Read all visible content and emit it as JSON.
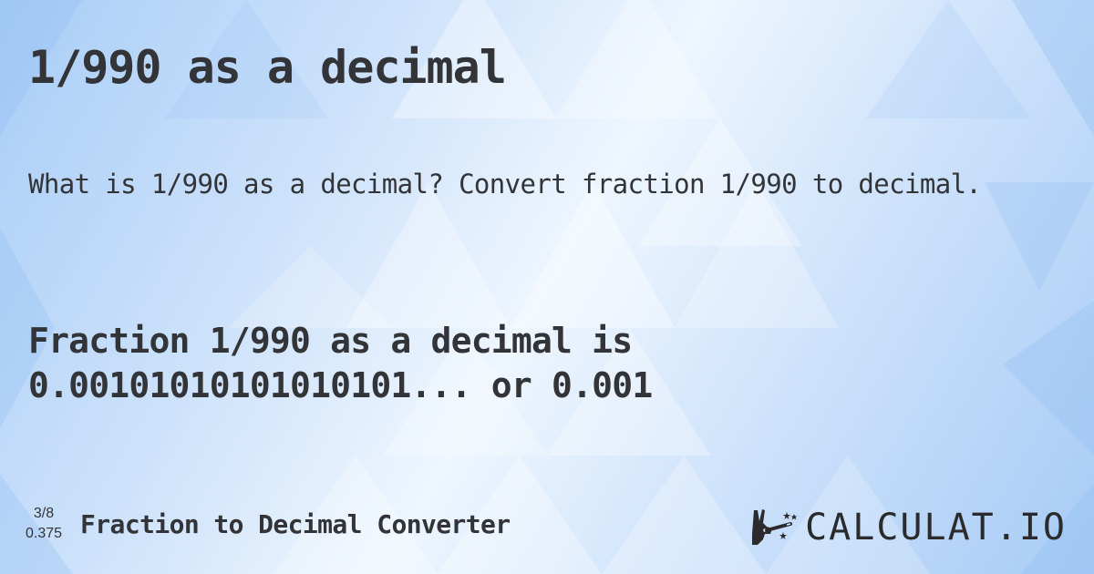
{
  "page": {
    "title": "1/990 as a decimal",
    "description": "What is 1/990 as a decimal? Convert fraction 1/990 to decimal.",
    "result_line1": "Fraction 1/990 as a decimal is",
    "result_line2": "0.00101010101010101... or 0.001"
  },
  "footer": {
    "example_fraction": "3/8",
    "example_decimal": "0.375",
    "converter_label": "Fraction to Decimal Converter",
    "logo_text": "CALCULAT.IO",
    "logo_icon": "hand-magic-wand-icon"
  },
  "colors": {
    "text": "#333438",
    "background_light": "#eef6fe",
    "background_blue": "#a9cdf6"
  }
}
